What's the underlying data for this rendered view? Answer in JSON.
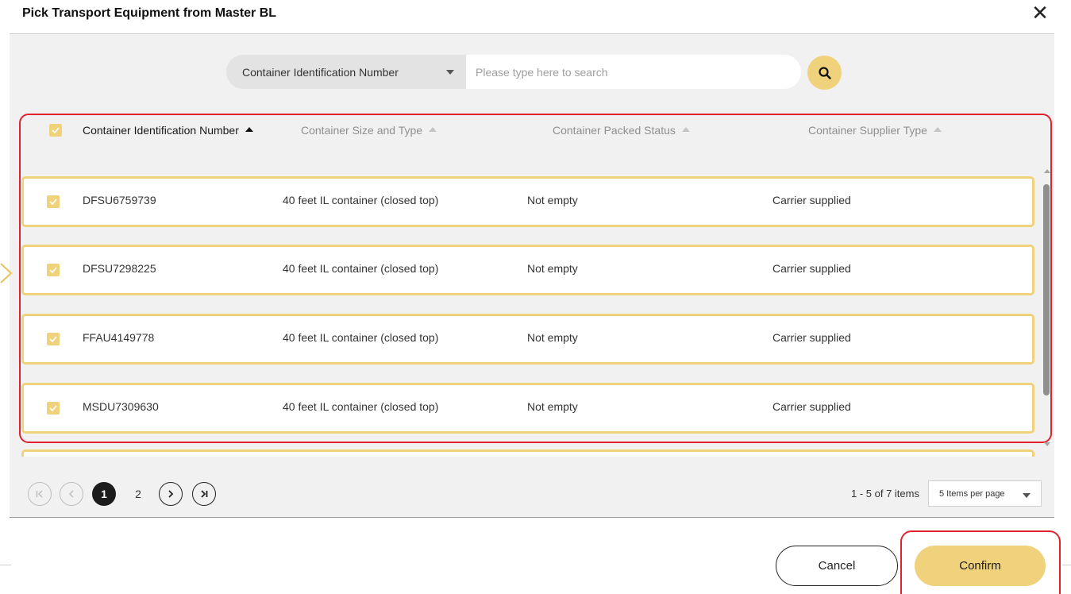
{
  "dialog": {
    "title": "Pick Transport Equipment from Master BL",
    "close_glyph": "✕"
  },
  "search": {
    "field_selected": "Container Identification Number",
    "placeholder": "Please type here to search"
  },
  "table": {
    "select_all_checked": true,
    "columns": [
      {
        "label": "Container Identification Number",
        "sort": "ascending",
        "active": true
      },
      {
        "label": "Container Size and Type",
        "sort": "ascending",
        "active": false
      },
      {
        "label": "Container Packed Status",
        "sort": "ascending",
        "active": false
      },
      {
        "label": "Container Supplier Type",
        "sort": "ascending",
        "active": false
      }
    ],
    "rows": [
      {
        "checked": true,
        "id": "DFSU6759739",
        "size_type": "40 feet IL container (closed top)",
        "packed": "Not empty",
        "supplier": "Carrier supplied"
      },
      {
        "checked": true,
        "id": "DFSU7298225",
        "size_type": "40 feet IL container (closed top)",
        "packed": "Not empty",
        "supplier": "Carrier supplied"
      },
      {
        "checked": true,
        "id": "FFAU4149778",
        "size_type": "40 feet IL container (closed top)",
        "packed": "Not empty",
        "supplier": "Carrier supplied"
      },
      {
        "checked": true,
        "id": "MSDU7309630",
        "size_type": "40 feet IL container (closed top)",
        "packed": "Not empty",
        "supplier": "Carrier supplied"
      }
    ]
  },
  "pagination": {
    "pages": [
      "1",
      "2"
    ],
    "current_page": "1",
    "items_info": "1 - 5 of 7 items",
    "per_page": "5 Items per page"
  },
  "footer": {
    "cancel_label": "Cancel",
    "confirm_label": "Confirm"
  },
  "colors": {
    "accent": "#efd27b",
    "highlight": "#e0222e",
    "panel_bg": "#f1f1f1"
  },
  "icons": [
    "close-icon",
    "search-icon",
    "checkbox-checked-icon",
    "sort-asc-icon",
    "first-page-icon",
    "prev-page-icon",
    "next-page-icon",
    "last-page-icon",
    "chevron-down-icon"
  ]
}
